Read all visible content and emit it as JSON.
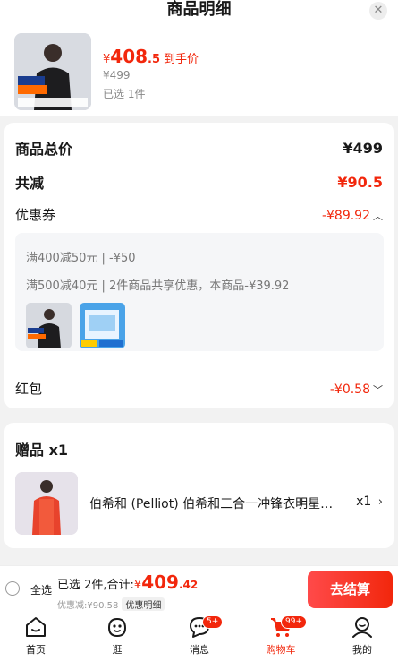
{
  "header": {
    "title": "商品明细"
  },
  "product": {
    "currency": "¥",
    "final_price_int": "408",
    "final_price_dec": ".5",
    "final_price_tag": "到手价",
    "original_price": "¥499",
    "selected_count": "已选 1件"
  },
  "summary": {
    "total_label": "商品总价",
    "total_value": "¥499",
    "reduce_label": "共减",
    "reduce_value": "¥90.5",
    "coupon_label": "优惠券",
    "coupon_value": "-¥89.92",
    "redpacket_label": "红包",
    "redpacket_value": "-¥0.58"
  },
  "coupons": [
    {
      "text": "满400减50元 | -¥50"
    },
    {
      "text": "满500减40元 | 2件商品共享优惠，本商品-¥39.92"
    }
  ],
  "gift": {
    "title": "赠品 x1",
    "name": "伯希和 (Pelliot) 伯希和三合一冲锋衣明星同款",
    "qty": "x1"
  },
  "bottom_bar": {
    "select_all": "全选",
    "selected_summary": "已选 2件,合计:",
    "currency": "¥",
    "total_int": "409",
    "total_dec": ".42",
    "discount_text": "优惠减:¥90.58",
    "detail_chip": "优惠明细",
    "checkout_label": "去结算"
  },
  "tabbar": [
    {
      "label": "首页",
      "icon": "home-icon"
    },
    {
      "label": "逛",
      "icon": "smile-face-icon"
    },
    {
      "label": "消息",
      "icon": "message-icon",
      "badge": "5+"
    },
    {
      "label": "购物车",
      "icon": "cart-icon",
      "badge": "99+",
      "active": true
    },
    {
      "label": "我的",
      "icon": "user-icon"
    }
  ],
  "colors": {
    "accent": "#f2270c",
    "background": "#f2f2f2"
  }
}
